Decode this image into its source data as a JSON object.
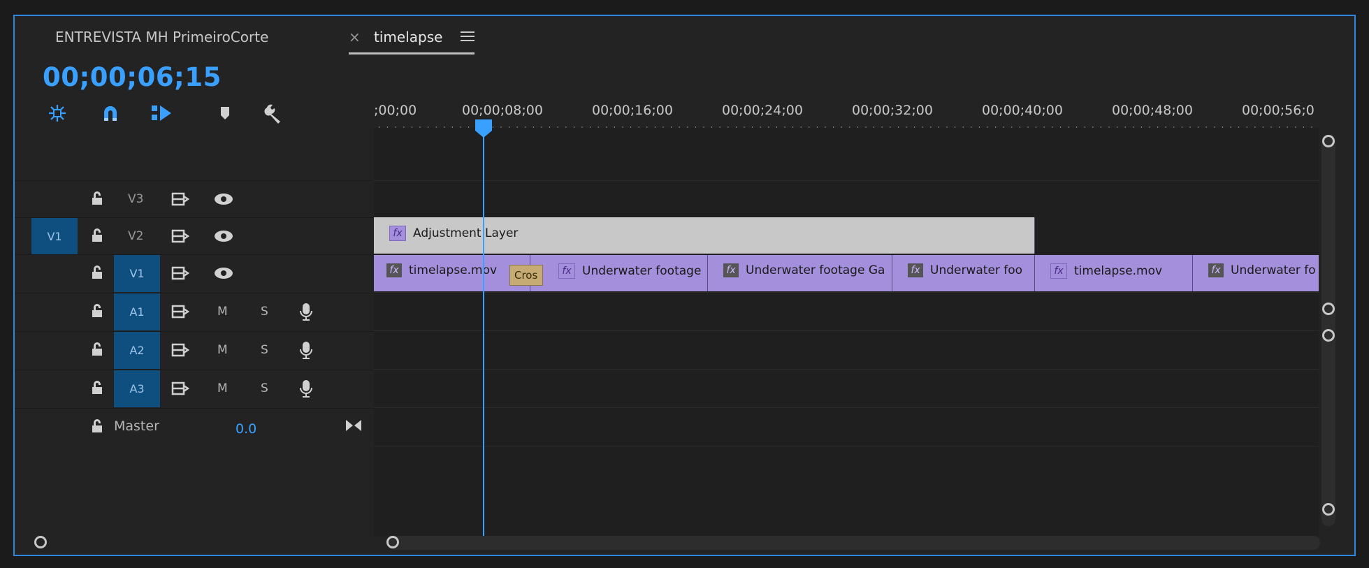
{
  "tabs": [
    {
      "label": "ENTREVISTA MH PrimeiroCorte",
      "active": false
    },
    {
      "label": "timelapse",
      "active": true
    }
  ],
  "tab_close": "×",
  "timecode": "00;00;06;15",
  "ruler": {
    "labels": [
      ";00;00",
      "00;00;08;00",
      "00;00;16;00",
      "00;00;24;00",
      "00;00;32;00",
      "00;00;40;00",
      "00;00;48;00",
      "00;00;56;0"
    ]
  },
  "tracks": {
    "v3": {
      "label": "V3"
    },
    "v2": {
      "label": "V2",
      "source": "V1"
    },
    "v1": {
      "label": "V1"
    },
    "a1": {
      "label": "A1",
      "m": "M",
      "s": "S"
    },
    "a2": {
      "label": "A2",
      "m": "M",
      "s": "S"
    },
    "a3": {
      "label": "A3",
      "m": "M",
      "s": "S"
    },
    "master": {
      "label": "Master",
      "value": "0.0"
    }
  },
  "clips": {
    "adjustment": "Adjustment Layer",
    "v1": [
      "timelapse.mov",
      "Underwater footage",
      "Underwater footage Ga",
      "Underwater foo",
      "timelapse.mov",
      "Underwater fo"
    ],
    "transition": "Cros"
  },
  "fx_label": "fx",
  "colors": {
    "accent": "#2e86de",
    "timecode": "#3aa0ff",
    "clip_video": "#a48fdc",
    "clip_adjustment": "#c8c8c8",
    "render_green": "#2fd12f",
    "render_red": "#e0301e",
    "target_on": "#0f4f80"
  }
}
